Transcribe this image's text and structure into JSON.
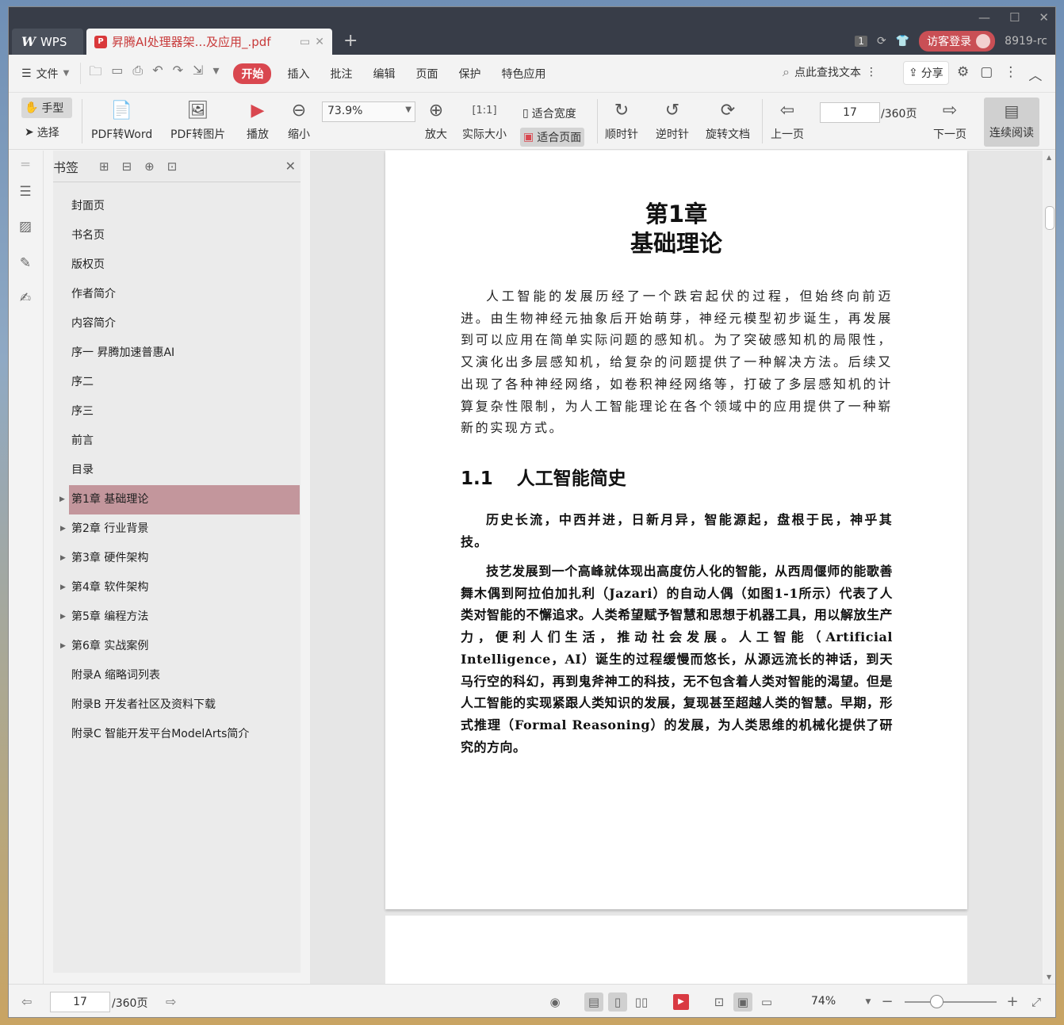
{
  "app": {
    "name": "WPS",
    "tab_title": "昇腾AI处理器架...及应用_.pdf",
    "window_count": "1",
    "login_label": "访客登录",
    "user_id": "8919-rc"
  },
  "menubar": {
    "file": "文件",
    "tabs": [
      "开始",
      "插入",
      "批注",
      "编辑",
      "页面",
      "保护",
      "特色应用"
    ],
    "search_label": "点此查找文本",
    "share_label": "分享"
  },
  "toolbar": {
    "hand": "手型",
    "select": "选择",
    "pdf_to_word": "PDF转Word",
    "pdf_to_image": "PDF转图片",
    "play": "播放",
    "zoom_out": "缩小",
    "zoom_value": "73.9%",
    "zoom_in": "放大",
    "actual_size": "实际大小",
    "fit_width": "适合宽度",
    "fit_page": "适合页面",
    "rotate_cw": "顺时针",
    "rotate_ccw": "逆时针",
    "rotate_doc": "旋转文档",
    "prev_page": "上一页",
    "current_page": "17",
    "total_pages": "/360页",
    "next_page": "下一页",
    "continuous": "连续阅读"
  },
  "bookmarks": {
    "title": "书签",
    "items": [
      {
        "label": "封面页",
        "expandable": false,
        "selected": false
      },
      {
        "label": "书名页",
        "expandable": false,
        "selected": false
      },
      {
        "label": "版权页",
        "expandable": false,
        "selected": false
      },
      {
        "label": "作者简介",
        "expandable": false,
        "selected": false
      },
      {
        "label": "内容简介",
        "expandable": false,
        "selected": false
      },
      {
        "label": "序一 昇腾加速普惠AI",
        "expandable": false,
        "selected": false
      },
      {
        "label": "序二",
        "expandable": false,
        "selected": false
      },
      {
        "label": "序三",
        "expandable": false,
        "selected": false
      },
      {
        "label": "前言",
        "expandable": false,
        "selected": false
      },
      {
        "label": "目录",
        "expandable": false,
        "selected": false
      },
      {
        "label": "第1章 基础理论",
        "expandable": true,
        "selected": true
      },
      {
        "label": "第2章 行业背景",
        "expandable": true,
        "selected": false
      },
      {
        "label": "第3章 硬件架构",
        "expandable": true,
        "selected": false
      },
      {
        "label": "第4章 软件架构",
        "expandable": true,
        "selected": false
      },
      {
        "label": "第5章 编程方法",
        "expandable": true,
        "selected": false
      },
      {
        "label": "第6章 实战案例",
        "expandable": true,
        "selected": false
      },
      {
        "label": "附录A 缩略词列表",
        "expandable": false,
        "selected": false
      },
      {
        "label": "附录B 开发者社区及资料下载",
        "expandable": false,
        "selected": false
      },
      {
        "label": "附录C 智能开发平台ModelArts简介",
        "expandable": false,
        "selected": false
      }
    ]
  },
  "document": {
    "chapter_number": "第1章",
    "chapter_title": "基础理论",
    "intro": "人工智能的发展历经了一个跌宕起伏的过程，但始终向前迈进。由生物神经元抽象后开始萌芽，神经元模型初步诞生，再发展到可以应用在简单实际问题的感知机。为了突破感知机的局限性，又演化出多层感知机，给复杂的问题提供了一种解决方法。后续又出现了各种神经网络，如卷积神经网络等，打破了多层感知机的计算复杂性限制，为人工智能理论在各个领域中的应用提供了一种崭新的实现方式。",
    "section_number": "1.1",
    "section_title": "人工智能简史",
    "para1": "历史长流，中西并进，日新月异，智能源起，盘根于民，神乎其技。",
    "para2": "技艺发展到一个高峰就体现出高度仿人化的智能，从西周偃师的能歌善舞木偶到阿拉伯加扎利（Jazari）的自动人偶（如图1-1所示）代表了人类对智能的不懈追求。人类希望赋予智慧和思想于机器工具，用以解放生产力，便利人们生活，推动社会发展。人工智能（Artificial Intelligence，AI）诞生的过程缓慢而悠长，从源远流长的神话，到天马行空的科幻，再到鬼斧神工的科技，无不包含着人类对智能的渴望。但是人工智能的实现紧跟人类知识的发展，复现甚至超越人类的智慧。早期，形式推理（Formal Reasoning）的发展，为人类思维的机械化提供了研究的方向。"
  },
  "statusbar": {
    "current_page": "17",
    "total_pages": "/360页",
    "zoom": "74%"
  },
  "colors": {
    "accent": "#d9474f",
    "selected_bookmark": "#c3969c",
    "titlebar": "#383d48"
  }
}
